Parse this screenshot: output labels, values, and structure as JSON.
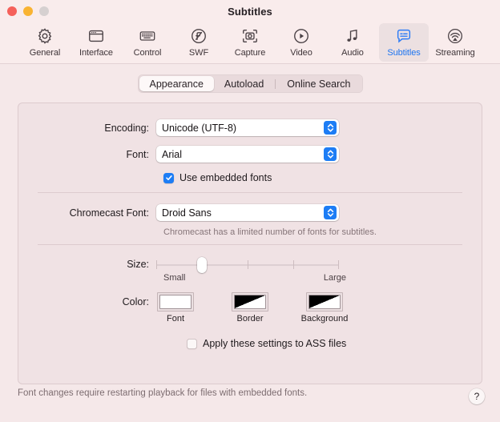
{
  "window": {
    "title": "Subtitles",
    "traffic_lights": [
      "close-button",
      "minimize-button",
      "zoom-button"
    ]
  },
  "toolbar": {
    "items": [
      {
        "label": "General",
        "icon": "gear-icon",
        "selected": false
      },
      {
        "label": "Interface",
        "icon": "window-icon",
        "selected": false
      },
      {
        "label": "Control",
        "icon": "keyboard-icon",
        "selected": false
      },
      {
        "label": "SWF",
        "icon": "flash-icon",
        "selected": false
      },
      {
        "label": "Capture",
        "icon": "camera-icon",
        "selected": false
      },
      {
        "label": "Video",
        "icon": "play-circle-icon",
        "selected": false
      },
      {
        "label": "Audio",
        "icon": "music-note-icon",
        "selected": false
      },
      {
        "label": "Subtitles",
        "icon": "subtitle-bubble-icon",
        "selected": true
      },
      {
        "label": "Streaming",
        "icon": "airplay-icon",
        "selected": false
      }
    ],
    "accent_color": "#1d74f0"
  },
  "tabs": [
    {
      "label": "Appearance",
      "active": true
    },
    {
      "label": "Autoload",
      "active": false
    },
    {
      "label": "Online Search",
      "active": false
    }
  ],
  "form": {
    "encoding": {
      "label": "Encoding:",
      "value": "Unicode (UTF-8)"
    },
    "font": {
      "label": "Font:",
      "value": "Arial"
    },
    "use_embedded_fonts": {
      "label": "Use embedded fonts",
      "checked": true
    },
    "chromecast_font": {
      "label": "Chromecast Font:",
      "value": "Droid Sans",
      "hint": "Chromecast has a limited number of fonts for subtitles."
    },
    "size": {
      "label": "Size:",
      "min_label": "Small",
      "max_label": "Large",
      "value_percent": 25,
      "tick_count": 5
    },
    "color": {
      "label": "Color:",
      "wells": [
        {
          "caption": "Font",
          "style": "solid",
          "color": "#ffffff"
        },
        {
          "caption": "Border",
          "style": "split",
          "color": "#000000"
        },
        {
          "caption": "Background",
          "style": "split",
          "color": "#000000"
        }
      ]
    },
    "apply_ass": {
      "label": "Apply these settings to ASS files",
      "checked": false
    }
  },
  "footer": {
    "note": "Font changes require restarting playback for files with embedded fonts.",
    "help_label": "?"
  }
}
